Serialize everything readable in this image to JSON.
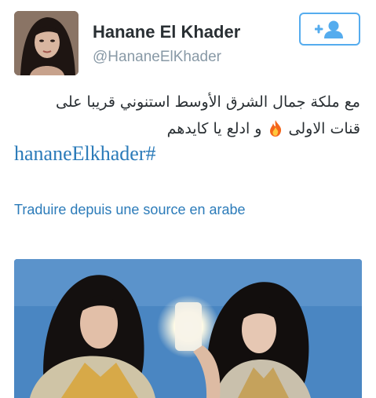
{
  "profile": {
    "display_name": "Hanane El Khader",
    "handle": "@HananeElKhader"
  },
  "follow_button": {
    "icon": "add-user-icon",
    "color": "#55acee"
  },
  "tweet": {
    "line1": "مع ملكة جمال الشرق الأوسط استنوني قريبا على",
    "line2_part1": "قنات الاولى",
    "line2_emoji": "fire-emoji",
    "line2_part2": "و ادلع يا كايدهم",
    "hashtag": "hananeElkhader#",
    "translate_link": "Traduire depuis une source en arabe"
  },
  "media": {
    "description_icon": "photo-two-women-mirror-selfie"
  },
  "colors": {
    "link": "#2b7bb9",
    "text": "#292f33",
    "secondary": "#8899a6"
  }
}
